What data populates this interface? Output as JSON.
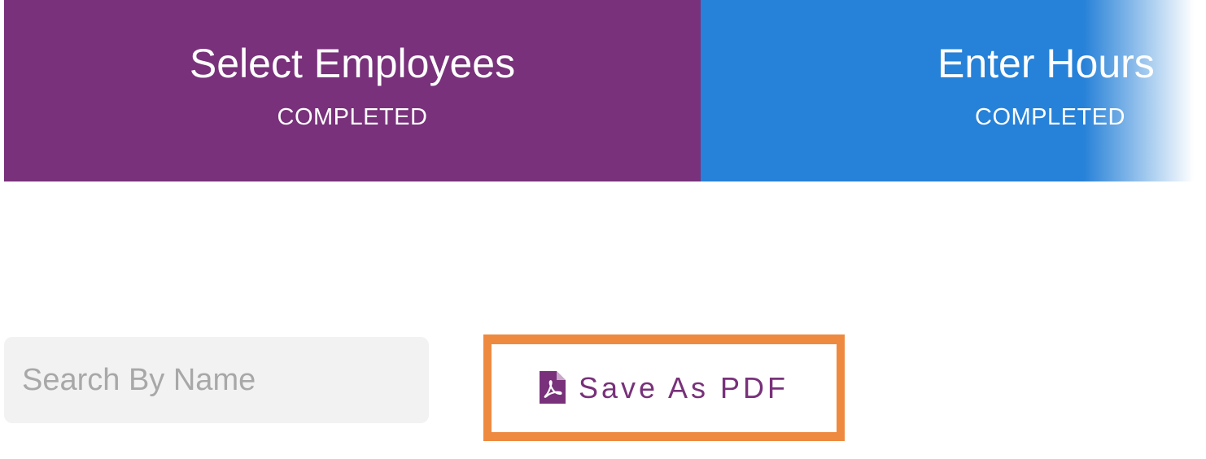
{
  "stepper": {
    "steps": [
      {
        "title": "Select Employees",
        "status": "COMPLETED"
      },
      {
        "title": "Enter Hours",
        "status": "COMPLETED"
      }
    ]
  },
  "search": {
    "placeholder": "Search By Name",
    "value": ""
  },
  "actions": {
    "save_pdf_label": "Save As PDF",
    "save_pdf_icon": "file-pdf-icon"
  },
  "colors": {
    "step_completed_primary": "#78317a",
    "step_completed_secondary": "#2681d8",
    "accent_text": "#78317a",
    "highlight_border": "#ee8a3f",
    "search_background": "#f2f2f2"
  }
}
